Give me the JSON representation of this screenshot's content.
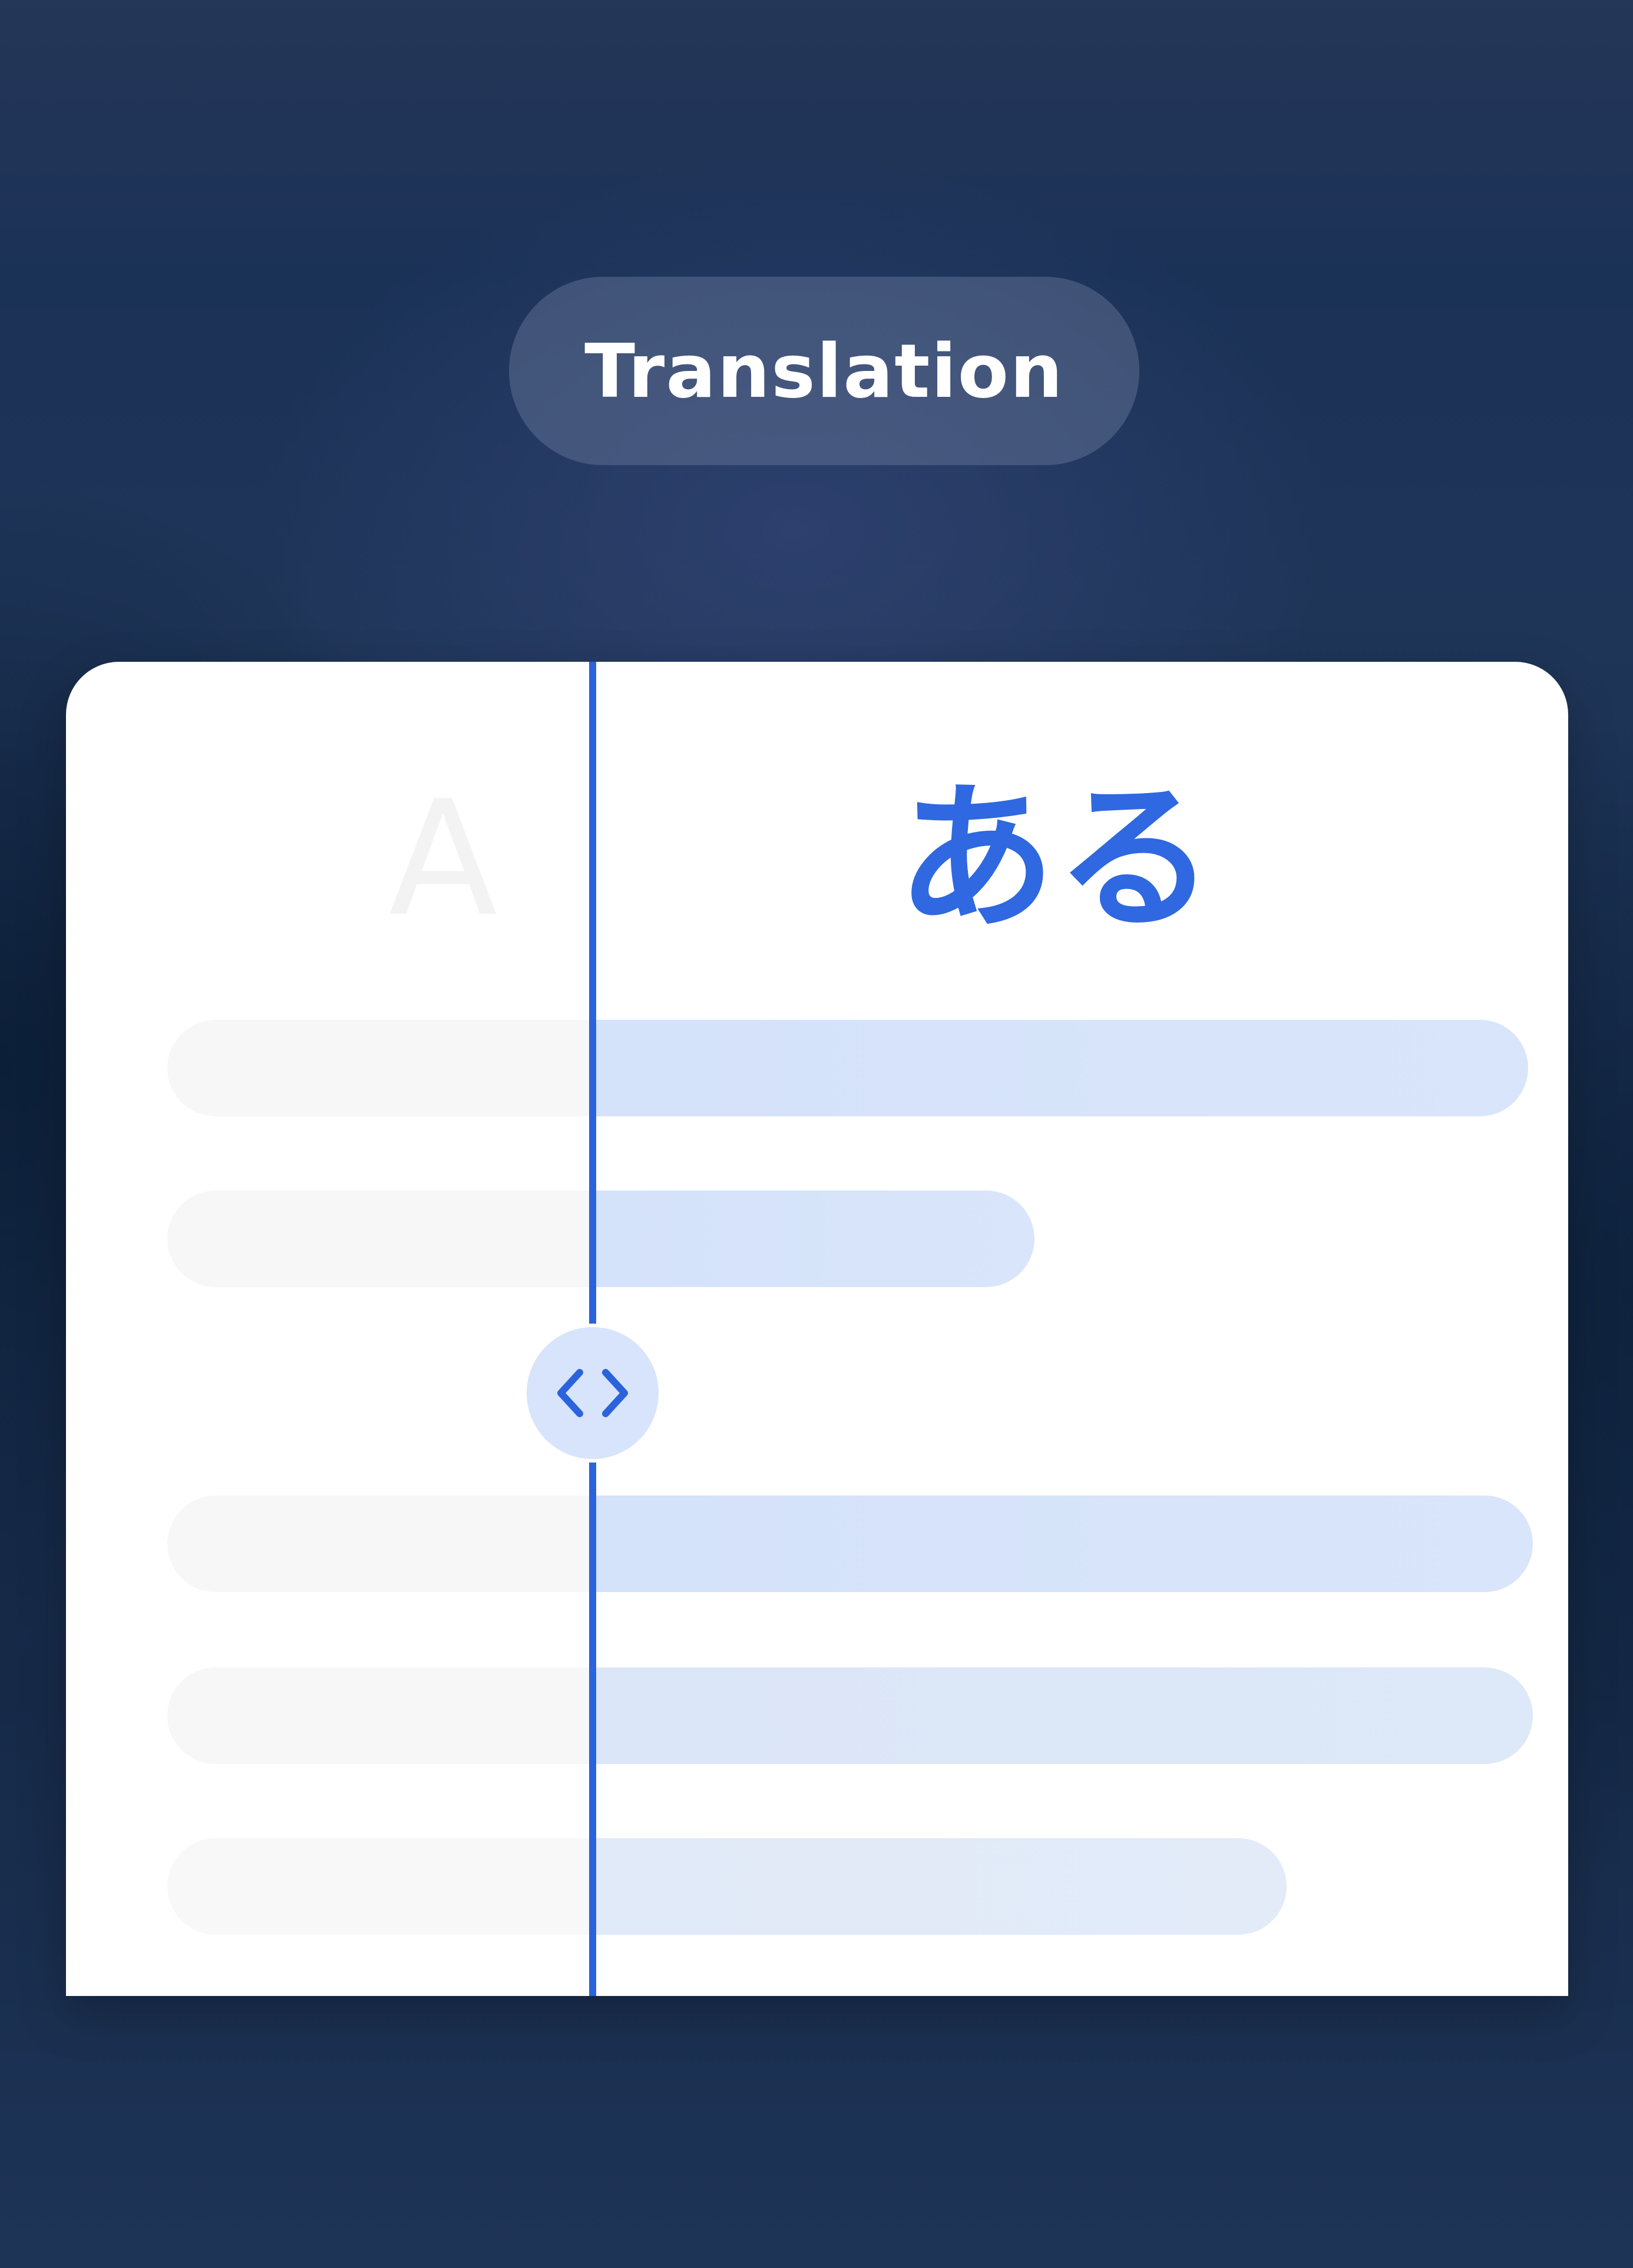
{
  "header": {
    "pill_label": "Translation"
  },
  "card": {
    "source_letter": "A",
    "target_text": "ある",
    "text_lines": 5
  },
  "comparison_slider": {
    "handle_icon": "chevron-left-right-icon"
  },
  "colors": {
    "accent": "#2b63dc",
    "target_line": "#d4e2fa",
    "source_line": "#f7f7f8",
    "pill_bg": "#5a6788",
    "background": "#1b3257"
  }
}
